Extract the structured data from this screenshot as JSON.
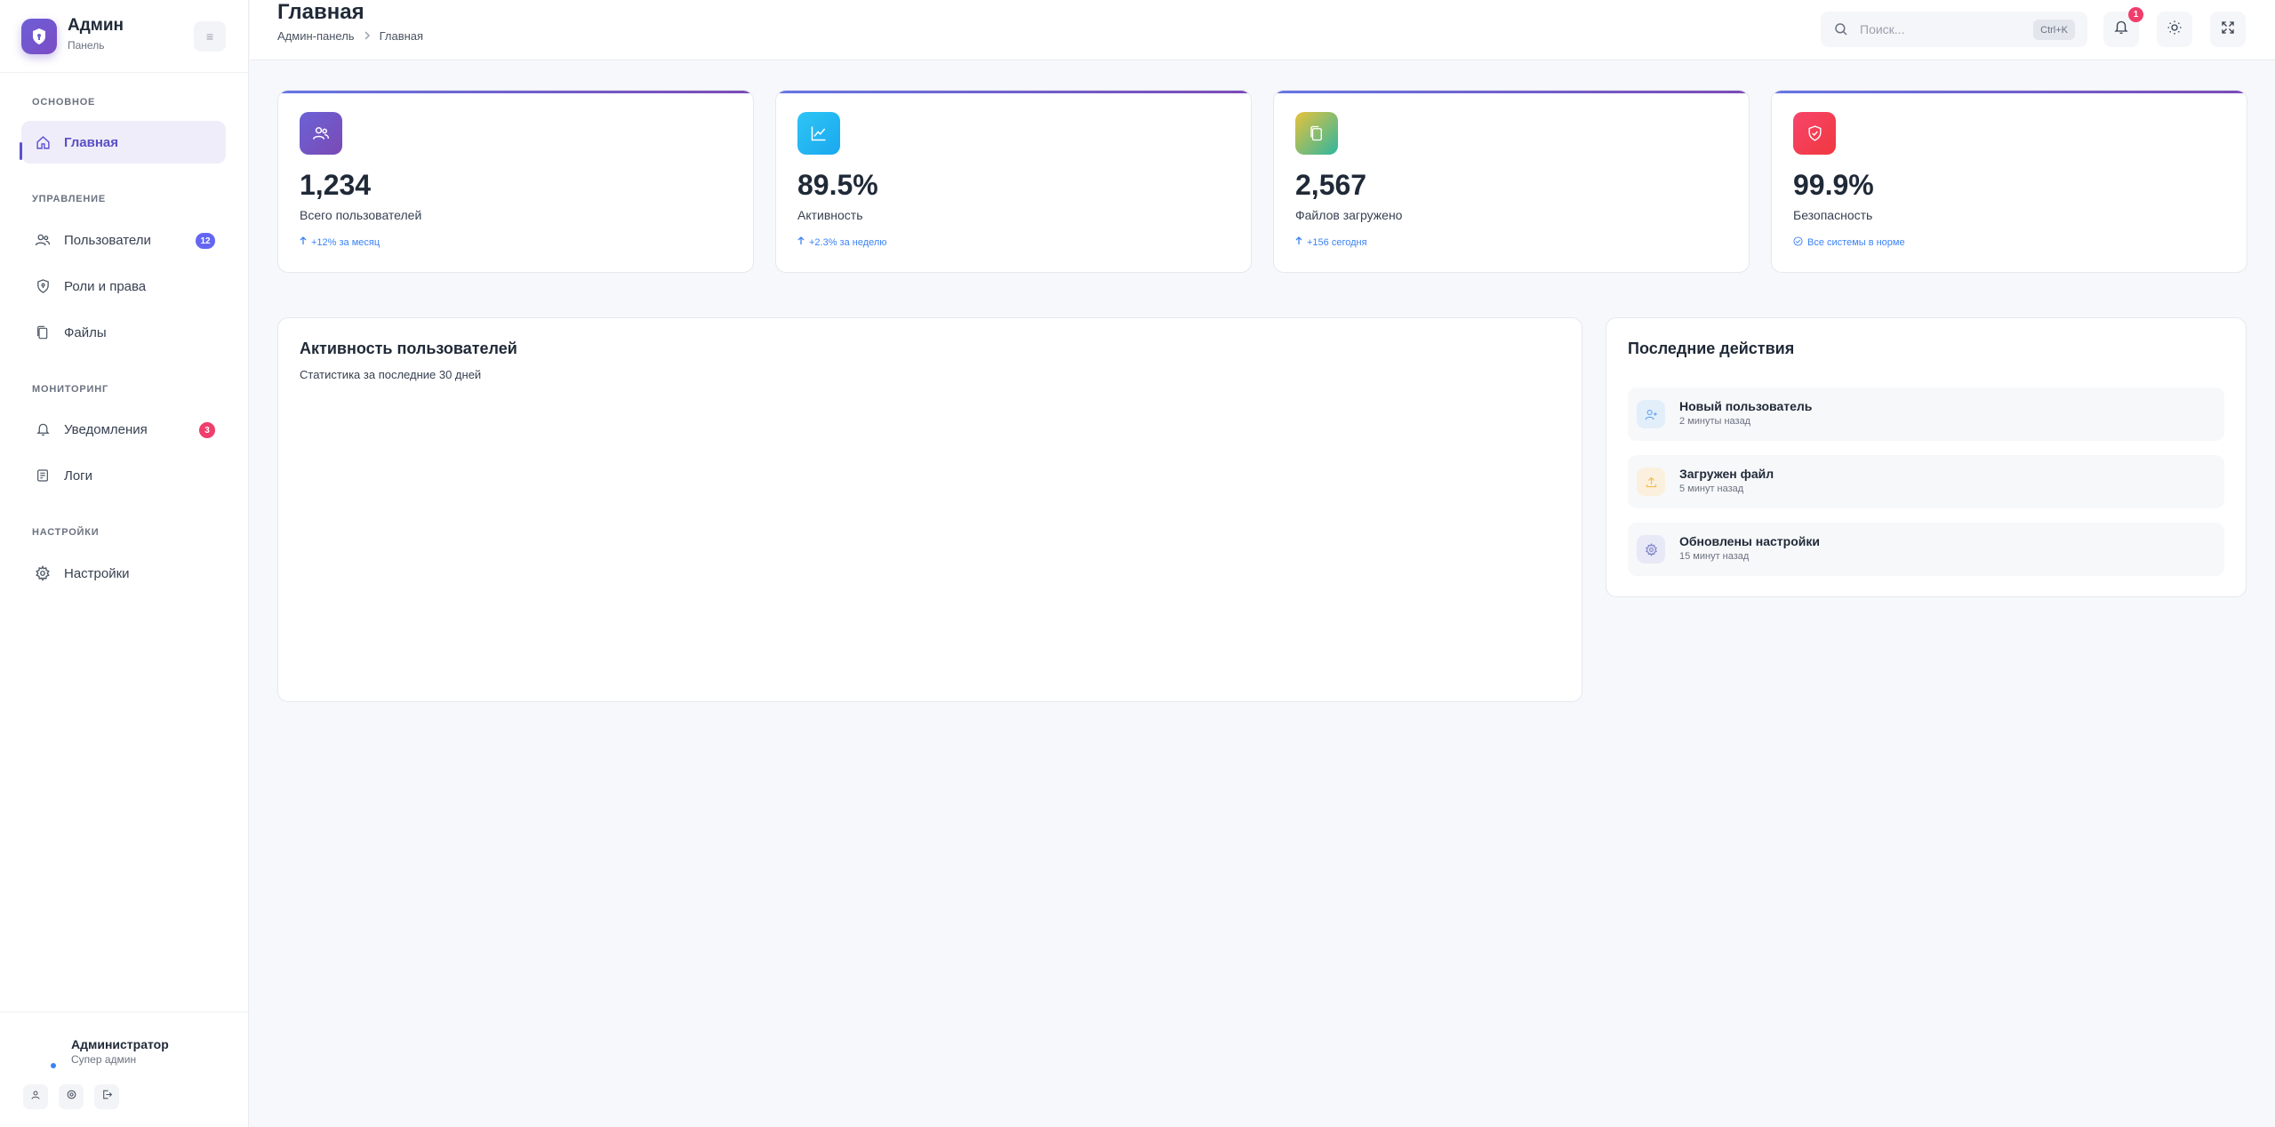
{
  "brand": {
    "title": "Админ",
    "subtitle": "Панель",
    "collapse_icon": "≡"
  },
  "sidebar": {
    "sections": [
      {
        "label": "ОСНОВНОЕ"
      },
      {
        "label": "УПРАВЛЕНИЕ"
      },
      {
        "label": "МОНИТОРИНГ"
      },
      {
        "label": "НАСТРОЙКИ"
      }
    ],
    "items": [
      {
        "label": "Главная",
        "icon": "home-icon",
        "active": true
      },
      {
        "label": "Пользователи",
        "icon": "users-icon",
        "badge": "12",
        "badge_color": "#6366f1"
      },
      {
        "label": "Роли и права",
        "icon": "shield-icon"
      },
      {
        "label": "Файлы",
        "icon": "files-icon"
      },
      {
        "label": "Уведомления",
        "icon": "bell-icon",
        "badge": "3",
        "badge_color": "#ef3e6b"
      },
      {
        "label": "Логи",
        "icon": "log-icon"
      },
      {
        "label": "Настройки",
        "icon": "gear-icon"
      }
    ]
  },
  "user": {
    "name": "Администратор",
    "role": "Супер админ",
    "status_color": "#3b82f6"
  },
  "header": {
    "title": "Главная",
    "breadcrumb": [
      "Админ-панель",
      "Главная"
    ],
    "search_placeholder": "Поиск...",
    "search_shortcut": "Ctrl+K",
    "notifications_count": "1"
  },
  "stats": [
    {
      "value": "1,234",
      "label": "Всего пользователей",
      "trend": "+12% за месяц",
      "icon": "users-icon"
    },
    {
      "value": "89.5%",
      "label": "Активность",
      "trend": "+2.3% за неделю",
      "icon": "chart-icon"
    },
    {
      "value": "2,567",
      "label": "Файлов загружено",
      "trend": "+156 сегодня",
      "icon": "files-icon"
    },
    {
      "value": "99.9%",
      "label": "Безопасность",
      "trend": "Все системы в норме",
      "icon": "shield-check-icon"
    }
  ],
  "activity_panel": {
    "title": "Активность пользователей",
    "subtitle": "Статистика за последние 30 дней"
  },
  "recent_panel": {
    "title": "Последние действия",
    "items": [
      {
        "title": "Новый пользователь",
        "time": "2 минуты назад",
        "icon": "user-plus-icon"
      },
      {
        "title": "Загружен файл",
        "time": "5 минут назад",
        "icon": "upload-icon"
      },
      {
        "title": "Обновлены настройки",
        "time": "15 минут назад",
        "icon": "gear-icon"
      }
    ]
  },
  "colors": {
    "accent": "#5b50d1",
    "card_stripe_start": "#6676e4",
    "card_stripe_end": "#7c4bb8",
    "trend": "#3b82f6"
  }
}
